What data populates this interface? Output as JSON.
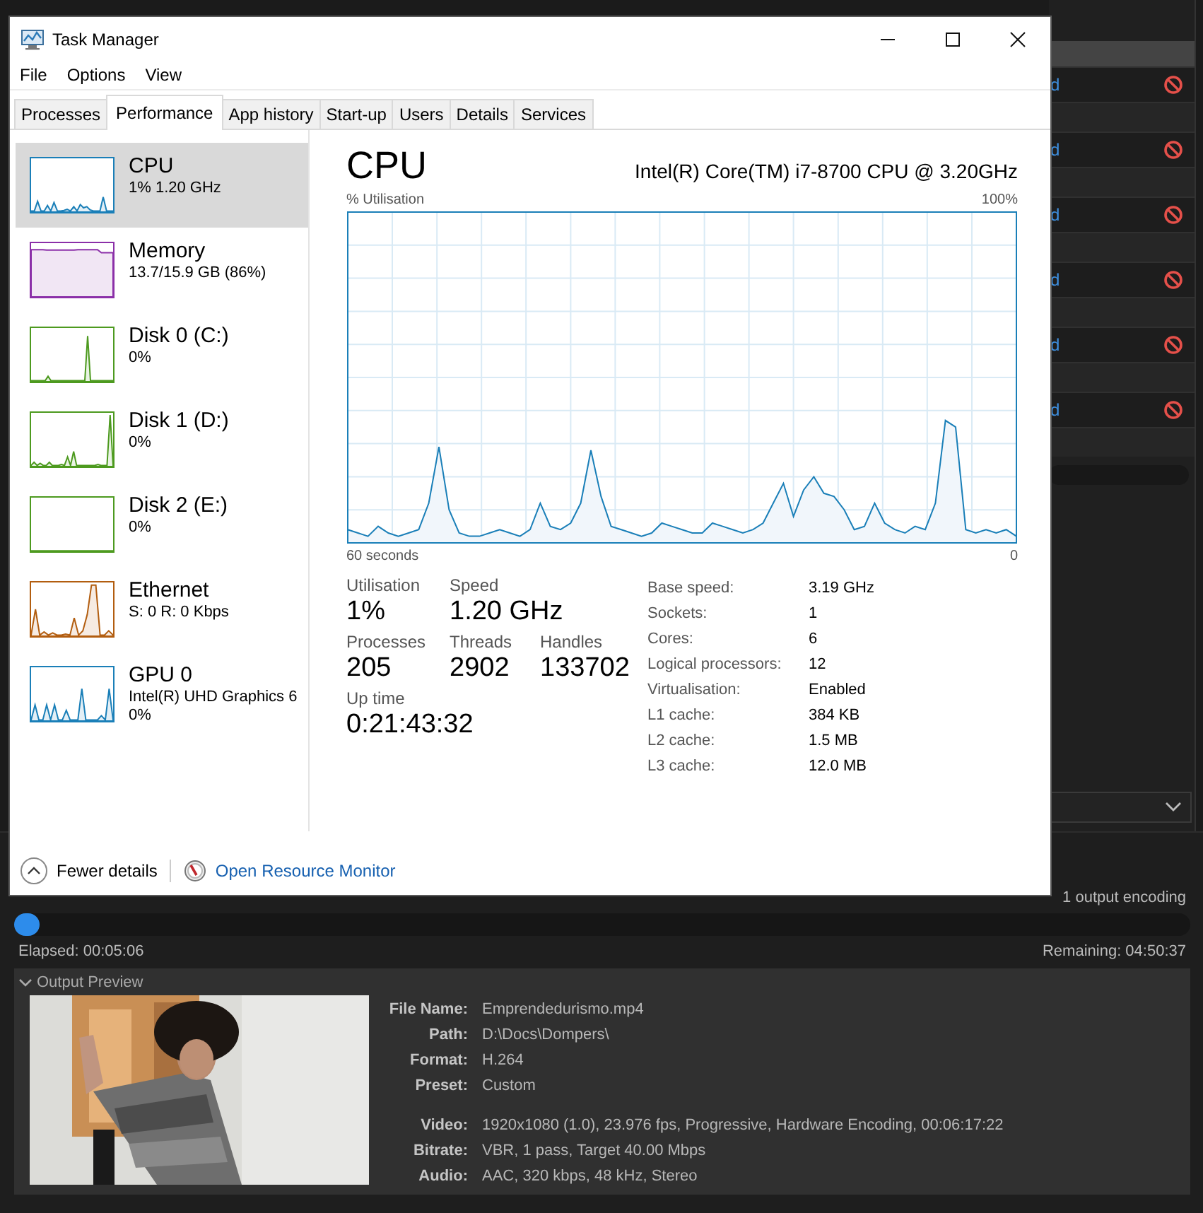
{
  "background_app": {
    "queue_rows": [
      {
        "status": "d"
      },
      {
        "status": "d"
      },
      {
        "status": "d"
      },
      {
        "status": "d"
      },
      {
        "status": "d"
      },
      {
        "status": "d"
      }
    ],
    "encoding": {
      "count_label": "1 output encoding",
      "level": 0.022,
      "elapsed": "Elapsed: 00:05:06",
      "remaining": "Remaining: 04:50:37"
    },
    "output_preview": {
      "title": "Output Preview",
      "expanded": true,
      "file_fields": [
        {
          "label": "File Name:",
          "value": "Emprendedurismo.mp4"
        },
        {
          "label": "Path:",
          "value": "D:\\Docs\\Dompers\\"
        },
        {
          "label": "Format:",
          "value": "H.264"
        },
        {
          "label": "Preset:",
          "value": "Custom"
        }
      ],
      "encoding_fields": [
        {
          "label": "Video:",
          "value": "1920x1080 (1.0), 23.976 fps, Progressive, Hardware Encoding, 00:06:17:22"
        },
        {
          "label": "Bitrate:",
          "value": "VBR, 1 pass, Target 40.00 Mbps"
        },
        {
          "label": "Audio:",
          "value": "AAC, 320 kbps, 48 kHz, Stereo"
        }
      ]
    }
  },
  "window": {
    "title": "Task Manager"
  },
  "menu": [
    "File",
    "Options",
    "View"
  ],
  "tabs": [
    {
      "label": "Processes",
      "selected": false
    },
    {
      "label": "Performance",
      "selected": true
    },
    {
      "label": "App history",
      "selected": false
    },
    {
      "label": "Start-up",
      "selected": false
    },
    {
      "label": "Users",
      "selected": false
    },
    {
      "label": "Details",
      "selected": false
    },
    {
      "label": "Services",
      "selected": false
    }
  ],
  "sidebar": {
    "items": [
      {
        "name": "CPU",
        "detail": "1% 1.20 GHz",
        "kind": "cpu",
        "color": "#1a7fb8",
        "selected": true
      },
      {
        "name": "Memory",
        "detail": "13.7/15.9 GB (86%)",
        "kind": "memory",
        "color": "#8b2fa8",
        "selected": false
      },
      {
        "name": "Disk 0 (C:)",
        "detail": "0%",
        "kind": "disk",
        "color": "#4d9a1f",
        "selected": false
      },
      {
        "name": "Disk 1 (D:)",
        "detail": "0%",
        "kind": "disk_busy",
        "color": "#4d9a1f",
        "selected": false
      },
      {
        "name": "Disk 2 (E:)",
        "detail": "0%",
        "kind": "disk_idle",
        "color": "#4d9a1f",
        "selected": false
      },
      {
        "name": "Ethernet",
        "detail": "S: 0 R: 0 Kbps",
        "kind": "network",
        "color": "#b25d0f",
        "selected": false
      },
      {
        "name": "GPU 0",
        "detail": "Intel(R) UHD Graphics 6",
        "detail_2": "0%",
        "kind": "gpu",
        "color": "#1a7fb8",
        "selected": false
      }
    ]
  },
  "details": {
    "title": "CPU",
    "model": "Intel(R) Core(TM) i7-8700 CPU @ 3.20GHz",
    "graph": {
      "y_label": "% Utilisation",
      "y_max": "100%",
      "x_label": "60 seconds",
      "x_min": "0"
    },
    "stats": [
      [
        {
          "label": "Utilisation",
          "value": "1%"
        },
        {
          "label": "Speed",
          "value": "1.20 GHz"
        }
      ],
      [
        {
          "label": "Processes",
          "value": "205"
        },
        {
          "label": "Threads",
          "value": "2902"
        },
        {
          "label": "Handles",
          "value": "133702"
        }
      ],
      [
        {
          "label": "Up time",
          "value": "0:21:43:32"
        }
      ]
    ],
    "specs": [
      {
        "label": "Base speed:",
        "value": "3.19 GHz"
      },
      {
        "label": "Sockets:",
        "value": "1"
      },
      {
        "label": "Cores:",
        "value": "6"
      },
      {
        "label": "Logical processors:",
        "value": "12"
      },
      {
        "label": "Virtualisation:",
        "value": "Enabled"
      },
      {
        "label": "L1 cache:",
        "value": "384 KB"
      },
      {
        "label": "L2 cache:",
        "value": "1.5 MB"
      },
      {
        "label": "L3 cache:",
        "value": "12.0 MB"
      }
    ]
  },
  "footer": {
    "fewer_details": "Fewer details",
    "resource_monitor": "Open Resource Monitor"
  }
}
